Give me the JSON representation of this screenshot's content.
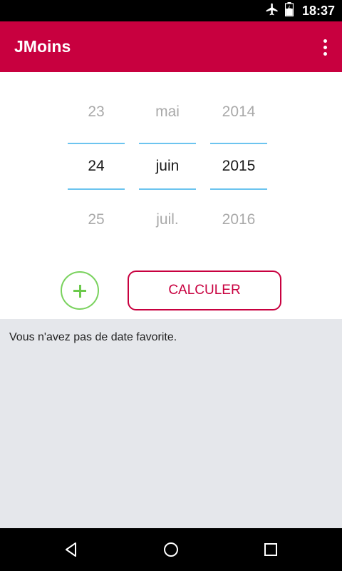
{
  "status_bar": {
    "time": "18:37",
    "icons": [
      "airplane-icon",
      "battery-charging-icon"
    ]
  },
  "app_bar": {
    "title": "JMoins",
    "menu_icon": "more-vert-icon"
  },
  "date_picker": {
    "day": {
      "prev": "23",
      "current": "24",
      "next": "25"
    },
    "month": {
      "prev": "mai",
      "current": "juin",
      "next": "juil."
    },
    "year": {
      "prev": "2014",
      "current": "2015",
      "next": "2016"
    }
  },
  "actions": {
    "add_icon": "plus-icon",
    "calculate_label": "CALCULER"
  },
  "favorites": {
    "empty_message": "Vous n'avez pas de date favorite."
  },
  "nav_bar": {
    "icons": [
      "back-icon",
      "home-icon",
      "recents-icon"
    ]
  },
  "colors": {
    "primary": "#c8003f",
    "accent_green": "#7ad25e",
    "picker_divider": "#6cc4ef",
    "panel_background": "#e5e7eb"
  }
}
